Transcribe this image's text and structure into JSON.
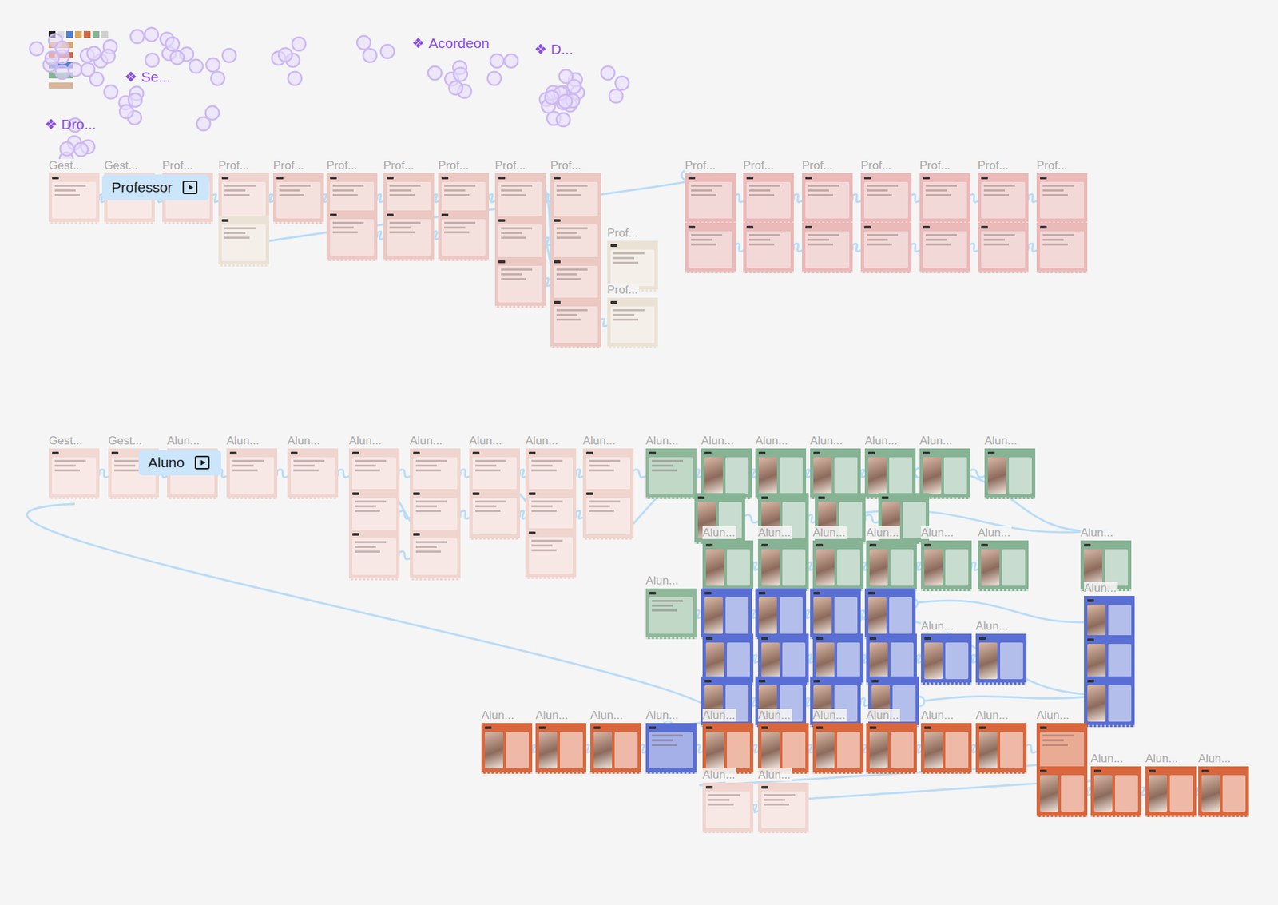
{
  "components": [
    {
      "icon": "❖",
      "label": "Acordeon"
    },
    {
      "icon": "❖",
      "label": "D..."
    },
    {
      "icon": "❖",
      "label": "Se..."
    },
    {
      "icon": "❖",
      "label": "Dro..."
    }
  ],
  "flows": [
    {
      "label": "Professor"
    },
    {
      "label": "Aluno"
    }
  ],
  "frames": [
    {
      "label": "Gest...",
      "color": "#f2d8d2",
      "kind": "plain"
    },
    {
      "label": "Gest...",
      "color": "#f2d8d2",
      "kind": "plain"
    },
    {
      "label": "Prof...",
      "color": "#efd3ce",
      "kind": "plain"
    },
    {
      "label": "Prof...",
      "color": "#efd3ce",
      "kind": "plain"
    },
    {
      "label": "Prof...",
      "color": "#ecc8c3",
      "kind": "plain"
    },
    {
      "label": "Prof...",
      "color": "#ecc8c3",
      "kind": "plain"
    },
    {
      "label": "Prof...",
      "color": "#ecc8c3",
      "kind": "plain"
    },
    {
      "label": "Prof...",
      "color": "#ecc8c3",
      "kind": "plain"
    },
    {
      "label": "Prof...",
      "color": "#ecc8c3",
      "kind": "plain"
    },
    {
      "label": "Prof...",
      "color": "#ecc8c3",
      "kind": "plain"
    },
    {
      "label": "Prof...",
      "color": "#eab9b8",
      "kind": "plain"
    },
    {
      "label": "Prof...",
      "color": "#eab9b8",
      "kind": "plain"
    },
    {
      "label": "Prof...",
      "color": "#eab9b8",
      "kind": "plain"
    },
    {
      "label": "Prof...",
      "color": "#eab9b8",
      "kind": "plain"
    },
    {
      "label": "Prof...",
      "color": "#eab9b8",
      "kind": "plain"
    },
    {
      "label": "Prof...",
      "color": "#eab9b8",
      "kind": "plain"
    },
    {
      "label": "Prof...",
      "color": "#eab9b8",
      "kind": "plain"
    },
    {
      "color": "#eab9b8",
      "kind": "plain"
    },
    {
      "color": "#eab9b8",
      "kind": "plain"
    },
    {
      "color": "#eab9b8",
      "kind": "plain"
    },
    {
      "color": "#eab9b8",
      "kind": "plain"
    },
    {
      "color": "#eab9b8",
      "kind": "plain"
    },
    {
      "color": "#eab9b8",
      "kind": "plain"
    },
    {
      "color": "#eab9b8",
      "kind": "plain"
    },
    {
      "color": "#ebe2d6",
      "kind": "plain"
    },
    {
      "color": "#ecc8c3",
      "kind": "plain"
    },
    {
      "color": "#ecc8c3",
      "kind": "plain"
    },
    {
      "color": "#ecc8c3",
      "kind": "plain"
    },
    {
      "color": "#ecc8c3",
      "kind": "plain"
    },
    {
      "color": "#ecc8c3",
      "kind": "plain"
    },
    {
      "color": "#ecc8c3",
      "kind": "plain"
    },
    {
      "color": "#ecc8c3",
      "kind": "plain"
    },
    {
      "label": "Prof...",
      "color": "#ebe2d6",
      "kind": "plain"
    },
    {
      "color": "#ecc8c3",
      "kind": "plain"
    },
    {
      "label": "Prof...",
      "color": "#ebe2d6",
      "kind": "plain"
    },
    {
      "label": "Gest...",
      "color": "#f2d8d2",
      "kind": "plain"
    },
    {
      "label": "Gest...",
      "color": "#f2d8d2",
      "kind": "plain"
    },
    {
      "label": "Alun...",
      "color": "#f0d5cf",
      "kind": "plain"
    },
    {
      "label": "Alun...",
      "color": "#f0d5cf",
      "kind": "plain"
    },
    {
      "label": "Alun...",
      "color": "#f0d5cf",
      "kind": "plain"
    },
    {
      "label": "Alun...",
      "color": "#f0d5cf",
      "kind": "plain"
    },
    {
      "label": "Alun...",
      "color": "#f0d5cf",
      "kind": "plain"
    },
    {
      "label": "Alun...",
      "color": "#f0d5cf",
      "kind": "plain"
    },
    {
      "label": "Alun...",
      "color": "#f0d5cf",
      "kind": "plain"
    },
    {
      "label": "Alun...",
      "color": "#f0d5cf",
      "kind": "plain"
    },
    {
      "label": "Alun...",
      "color": "#8fb89a",
      "kind": "plain"
    },
    {
      "label": "Alun...",
      "color": "#86b394",
      "kind": "photo"
    },
    {
      "label": "Alun...",
      "color": "#86b394",
      "kind": "photo"
    },
    {
      "label": "Alun...",
      "color": "#86b394",
      "kind": "photo"
    },
    {
      "label": "Alun...",
      "color": "#86b394",
      "kind": "photo"
    },
    {
      "label": "Alun...",
      "color": "#86b394",
      "kind": "photo"
    },
    {
      "label": "Alun...",
      "color": "#86b394",
      "kind": "photo"
    },
    {
      "color": "#f0d5cf",
      "kind": "plain"
    },
    {
      "color": "#f0d5cf",
      "kind": "plain"
    },
    {
      "color": "#f0d5cf",
      "kind": "plain"
    },
    {
      "color": "#f0d5cf",
      "kind": "plain"
    },
    {
      "color": "#f0d5cf",
      "kind": "plain"
    },
    {
      "color": "#f0d5cf",
      "kind": "plain"
    },
    {
      "color": "#f0d5cf",
      "kind": "plain"
    },
    {
      "color": "#f0d5cf",
      "kind": "plain"
    },
    {
      "color": "#86b394",
      "kind": "photo"
    },
    {
      "color": "#86b394",
      "kind": "photo"
    },
    {
      "color": "#86b394",
      "kind": "photo"
    },
    {
      "color": "#86b394",
      "kind": "photo"
    },
    {
      "label": "Alun...",
      "color": "#86b394",
      "kind": "photo"
    },
    {
      "label": "Alun...",
      "color": "#86b394",
      "kind": "photo"
    },
    {
      "label": "Alun...",
      "color": "#86b394",
      "kind": "photo"
    },
    {
      "label": "Alun...",
      "color": "#86b394",
      "kind": "photo"
    },
    {
      "label": "Alun...",
      "color": "#86b394",
      "kind": "photo"
    },
    {
      "label": "Alun...",
      "color": "#86b394",
      "kind": "photo"
    },
    {
      "label": "Alun...",
      "color": "#86b394",
      "kind": "photo"
    },
    {
      "label": "Alun...",
      "color": "#8fb89a",
      "kind": "plain"
    },
    {
      "color": "#5a6fd3",
      "kind": "photo"
    },
    {
      "color": "#5a6fd3",
      "kind": "photo"
    },
    {
      "color": "#5a6fd3",
      "kind": "photo"
    },
    {
      "color": "#5a6fd3",
      "kind": "photo"
    },
    {
      "label": "Alun...",
      "color": "#5a6fd3",
      "kind": "photo"
    },
    {
      "color": "#5a6fd3",
      "kind": "photo"
    },
    {
      "color": "#5a6fd3",
      "kind": "photo"
    },
    {
      "color": "#5a6fd3",
      "kind": "photo"
    },
    {
      "color": "#5a6fd3",
      "kind": "photo"
    },
    {
      "label": "Alun...",
      "color": "#5a6fd3",
      "kind": "photo"
    },
    {
      "label": "Alun...",
      "color": "#5a6fd3",
      "kind": "photo"
    },
    {
      "color": "#5a6fd3",
      "kind": "photo"
    },
    {
      "color": "#5a6fd3",
      "kind": "photo"
    },
    {
      "color": "#5a6fd3",
      "kind": "photo"
    },
    {
      "color": "#5a6fd3",
      "kind": "photo"
    },
    {
      "color": "#5a6fd3",
      "kind": "photo"
    },
    {
      "color": "#5a6fd3",
      "kind": "photo"
    },
    {
      "label": "Alun...",
      "color": "#d9673d",
      "kind": "photo"
    },
    {
      "label": "Alun...",
      "color": "#d9673d",
      "kind": "photo"
    },
    {
      "label": "Alun...",
      "color": "#d9673d",
      "kind": "photo"
    },
    {
      "label": "Alun...",
      "color": "#5a6fd3",
      "kind": "plain"
    },
    {
      "label": "Alun...",
      "color": "#d9673d",
      "kind": "photo"
    },
    {
      "label": "Alun...",
      "color": "#d9673d",
      "kind": "photo"
    },
    {
      "label": "Alun...",
      "color": "#d9673d",
      "kind": "photo"
    },
    {
      "label": "Alun...",
      "color": "#d9673d",
      "kind": "photo"
    },
    {
      "label": "Alun...",
      "color": "#d9673d",
      "kind": "photo"
    },
    {
      "label": "Alun...",
      "color": "#d9673d",
      "kind": "photo"
    },
    {
      "label": "Alun...",
      "color": "#d9673d",
      "kind": "plain"
    },
    {
      "color": "#d9673d",
      "kind": "photo"
    },
    {
      "label": "Alun...",
      "color": "#d9673d",
      "kind": "photo"
    },
    {
      "label": "Alun...",
      "color": "#d9673d",
      "kind": "photo"
    },
    {
      "label": "Alun...",
      "color": "#d9673d",
      "kind": "photo"
    },
    {
      "label": "Alun...",
      "color": "#f0d5cf",
      "kind": "plain"
    },
    {
      "label": "Alun...",
      "color": "#f0d5cf",
      "kind": "plain"
    }
  ]
}
